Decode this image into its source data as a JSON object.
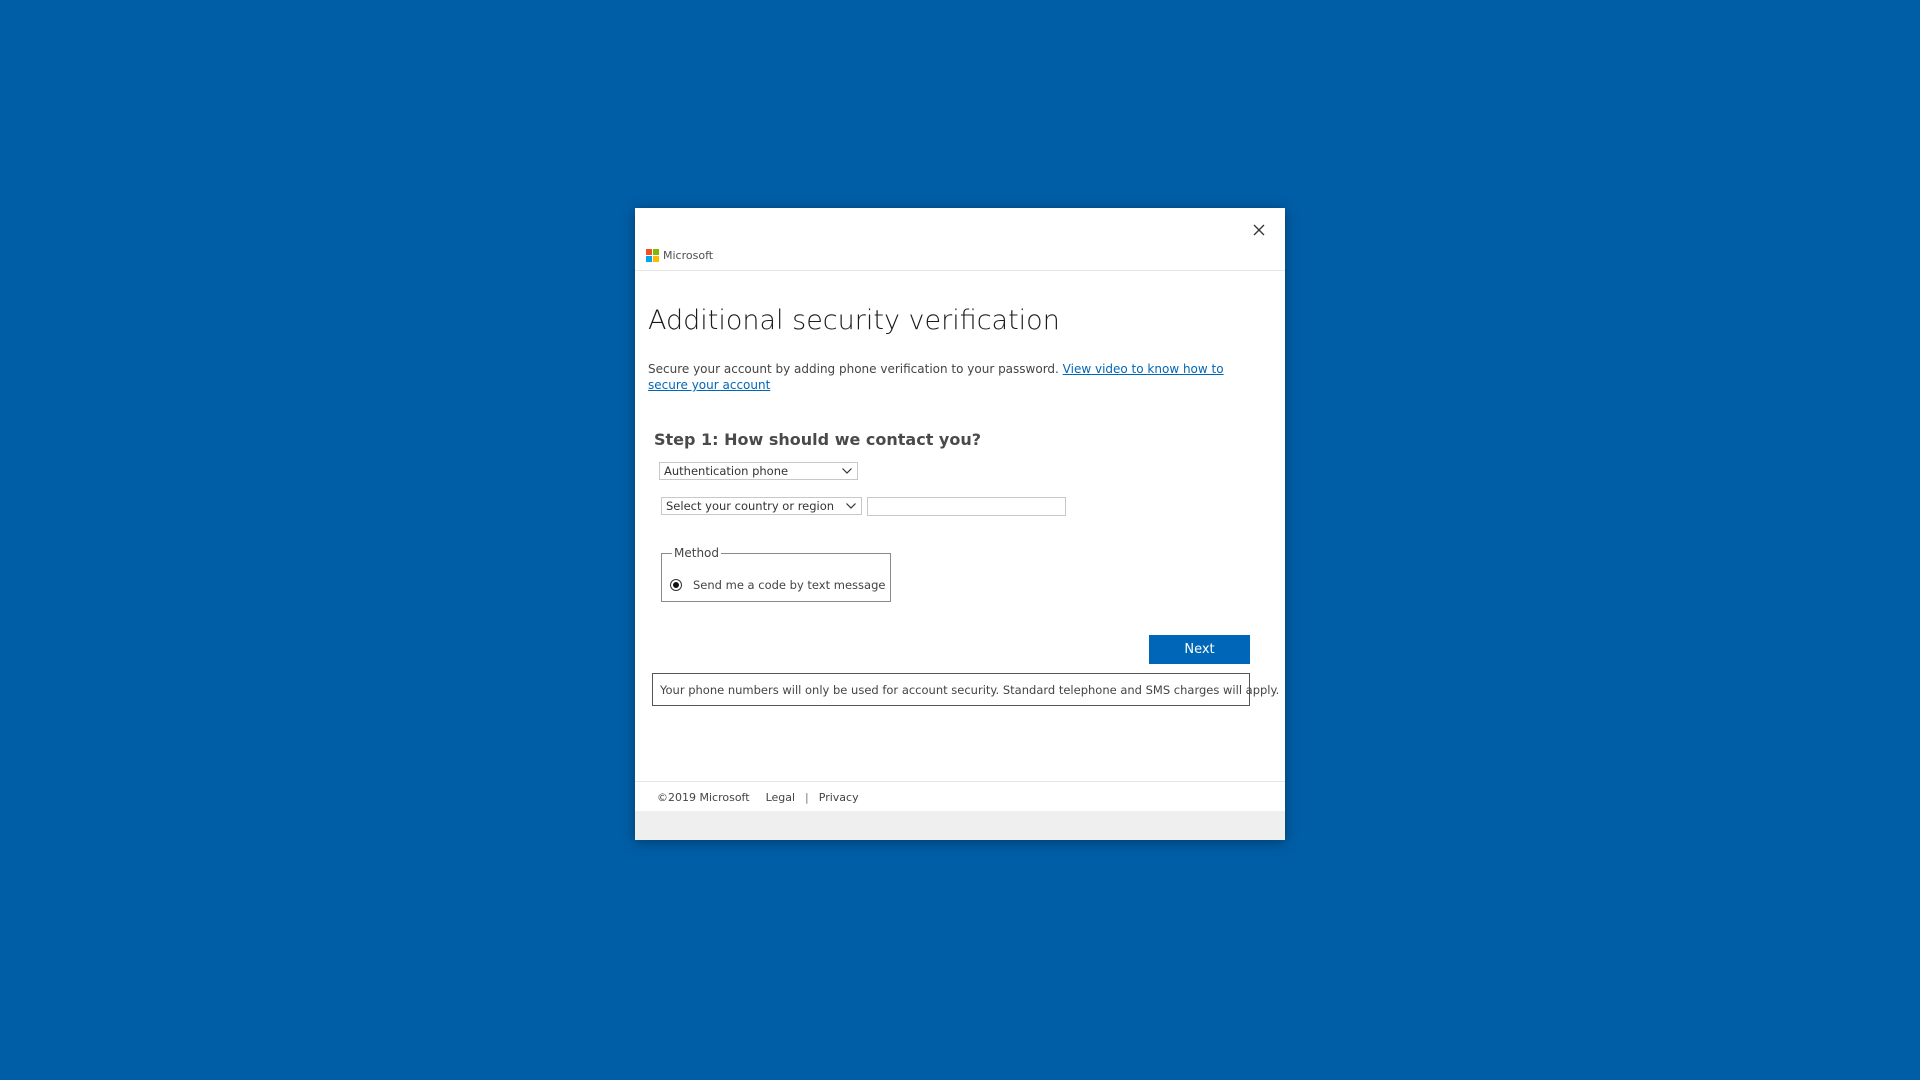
{
  "colors": {
    "background": "#005ea6",
    "dialog": "#ffffff",
    "accent": "#0067b8",
    "logo_red": "#f25022",
    "logo_green": "#7fba00",
    "logo_blue": "#00a4ef",
    "logo_yellow": "#ffb900"
  },
  "header": {
    "brand": "Microsoft",
    "close_icon": "close-icon"
  },
  "page": {
    "title": "Additional security verification",
    "intro_text": "Secure your account by adding phone verification to your password. ",
    "intro_link": "View video to know how to secure your account"
  },
  "step1": {
    "title": "Step 1: How should we contact you?",
    "contact_method": "Authentication phone",
    "country": "Select your country or region",
    "phone_value": ""
  },
  "method": {
    "legend": "Method",
    "option": "Send me a code by text message",
    "selected": true
  },
  "actions": {
    "next_label": "Next"
  },
  "notice": "Your phone numbers will only be used for account security. Standard telephone and SMS charges will apply.",
  "footer": {
    "copyright": "©2019 Microsoft",
    "legal": "Legal",
    "separator": "|",
    "privacy": "Privacy"
  }
}
